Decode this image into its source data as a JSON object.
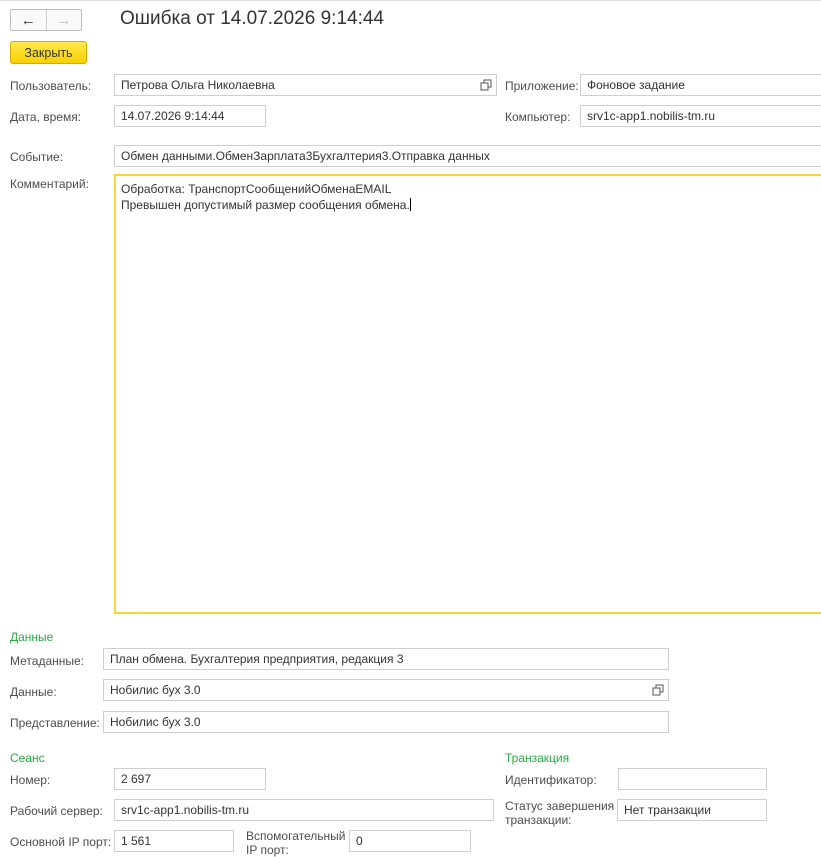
{
  "window": {
    "title": "Ошибка от 14.07.2026 9:14:44"
  },
  "toolbar": {
    "back_icon": "←",
    "forward_icon": "→",
    "close_label": "Закрыть"
  },
  "fields": {
    "user_label": "Пользователь:",
    "user_value": "Петрова Ольга Николаевна",
    "app_label": "Приложение:",
    "app_value": "Фоновое задание",
    "datetime_label": "Дата, время:",
    "datetime_value": "14.07.2026  9:14:44",
    "computer_label": "Компьютер:",
    "computer_value": "srv1c-app1.nobilis-tm.ru",
    "event_label": "Событие:",
    "event_value": "Обмен данными.ОбменЗарплата3Бухгалтерия3.Отправка данных",
    "comment_label": "Комментарий:",
    "comment_line1": "Обработка: ТранспортСообщенийОбменаEMAIL",
    "comment_line2": "Превышен допустимый размер сообщения обмена."
  },
  "data_section": {
    "title": "Данные",
    "metadata_label": "Метаданные:",
    "metadata_value": "План обмена. Бухгалтерия предприятия, редакция 3",
    "data_label": "Данные:",
    "data_value": "Нобилис бух 3.0",
    "representation_label": "Представление:",
    "representation_value": "Нобилис бух 3.0"
  },
  "session_section": {
    "title": "Сеанс",
    "number_label": "Номер:",
    "number_value": "2 697",
    "server_label": "Рабочий сервер:",
    "server_value": "srv1c-app1.nobilis-tm.ru",
    "main_port_label": "Основной IP порт:",
    "main_port_value": "1 561",
    "aux_port_label_line1": "Вспомогательный",
    "aux_port_label_line2": "IP порт:",
    "aux_port_value": "0"
  },
  "transaction_section": {
    "title": "Транзакция",
    "id_label": "Идентификатор:",
    "id_value": "",
    "status_label_line1": "Статус завершения",
    "status_label_line2": "транзакции:",
    "status_value": "Нет транзакции"
  },
  "colors": {
    "accent_green": "#2aa843",
    "button_yellow": "#f6d000",
    "focus_border": "#f5d73c"
  },
  "icons": {
    "open": "open-in-window-icon"
  }
}
